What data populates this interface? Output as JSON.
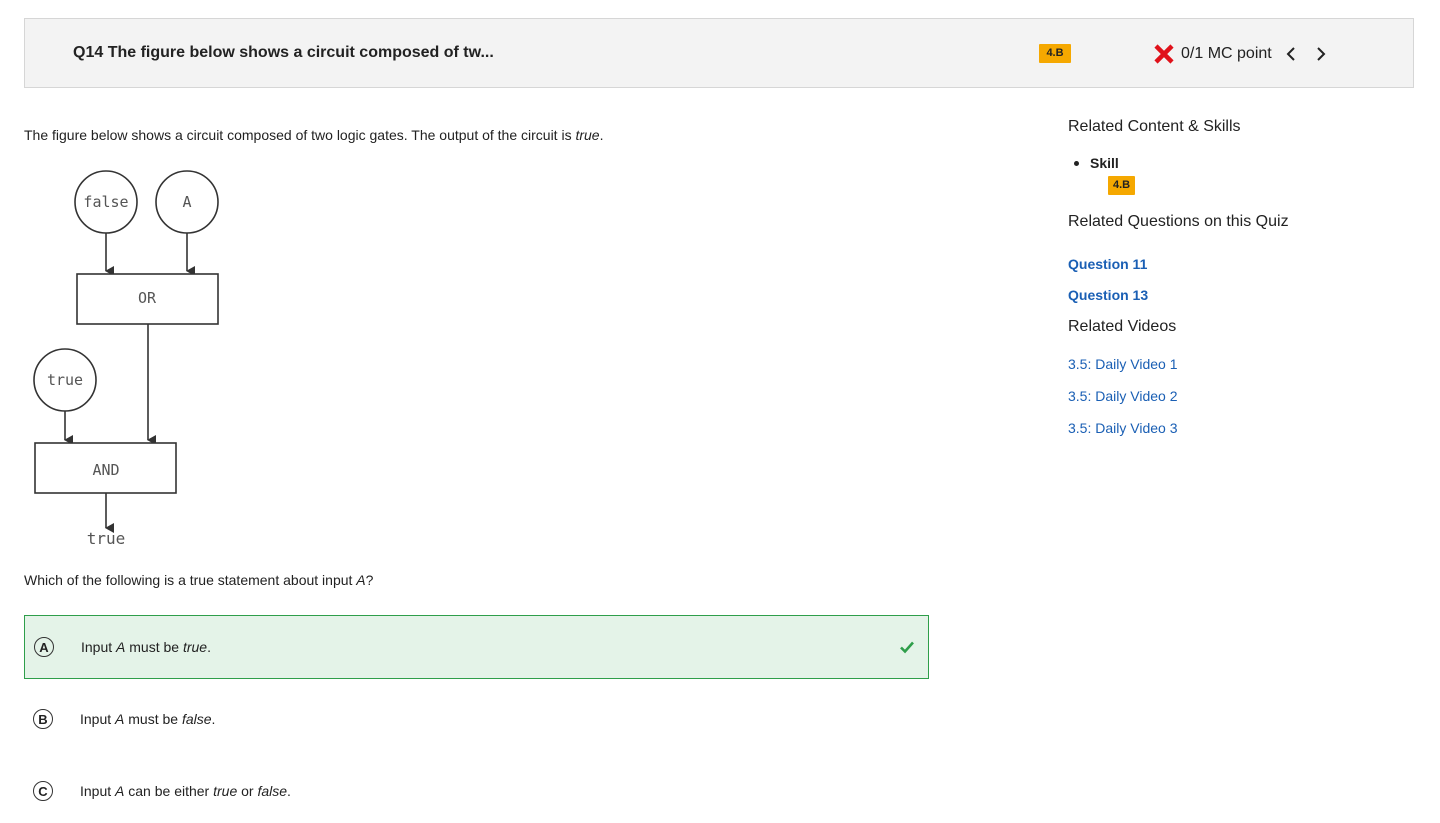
{
  "header": {
    "title": "Q14 The figure below shows a circuit composed of tw...",
    "skill_badge": "4.B",
    "score": "0/1 MC point"
  },
  "question": {
    "stem_prefix": "The figure below shows a circuit composed of two logic gates. The output of the circuit is ",
    "stem_emph": "true",
    "stem_suffix": ".",
    "prompt_prefix": "Which of the following is a true statement about input ",
    "prompt_var": "A",
    "prompt_suffix": "?"
  },
  "diagram": {
    "input_false": "false",
    "input_a": "A",
    "gate_or": "OR",
    "input_true": "true",
    "gate_and": "AND",
    "output": "true"
  },
  "choices": [
    {
      "letter": "A",
      "pre": "Input ",
      "var": "A",
      "mid": " must be ",
      "emph": "true",
      "mid2": "",
      "emph2": "",
      "post": "."
    },
    {
      "letter": "B",
      "pre": "Input ",
      "var": "A",
      "mid": " must be ",
      "emph": "false",
      "mid2": "",
      "emph2": "",
      "post": "."
    },
    {
      "letter": "C",
      "pre": "Input ",
      "var": "A",
      "mid": " can be either ",
      "emph": "true",
      "mid2": " or ",
      "emph2": "false",
      "post": "."
    }
  ],
  "sidebar": {
    "related_content_heading": "Related Content & Skills",
    "skill_label": "Skill",
    "skill_badge": "4.B",
    "related_questions_heading": "Related Questions on this Quiz",
    "questions": [
      "Question 11",
      "Question 13"
    ],
    "related_videos_heading": "Related Videos",
    "videos": [
      "3.5: Daily Video 1",
      "3.5: Daily Video 2",
      "3.5: Daily Video 3"
    ]
  },
  "colors": {
    "badge": "#f5a800",
    "correct_bg": "#e4f3e8",
    "correct_border": "#2e9e4a",
    "wrong_icon": "#e0111a",
    "link": "#1a5fb4"
  },
  "icons": {
    "wrong": "x-mark-icon",
    "prev": "chevron-left-icon",
    "next": "chevron-right-icon",
    "correct": "check-icon"
  }
}
